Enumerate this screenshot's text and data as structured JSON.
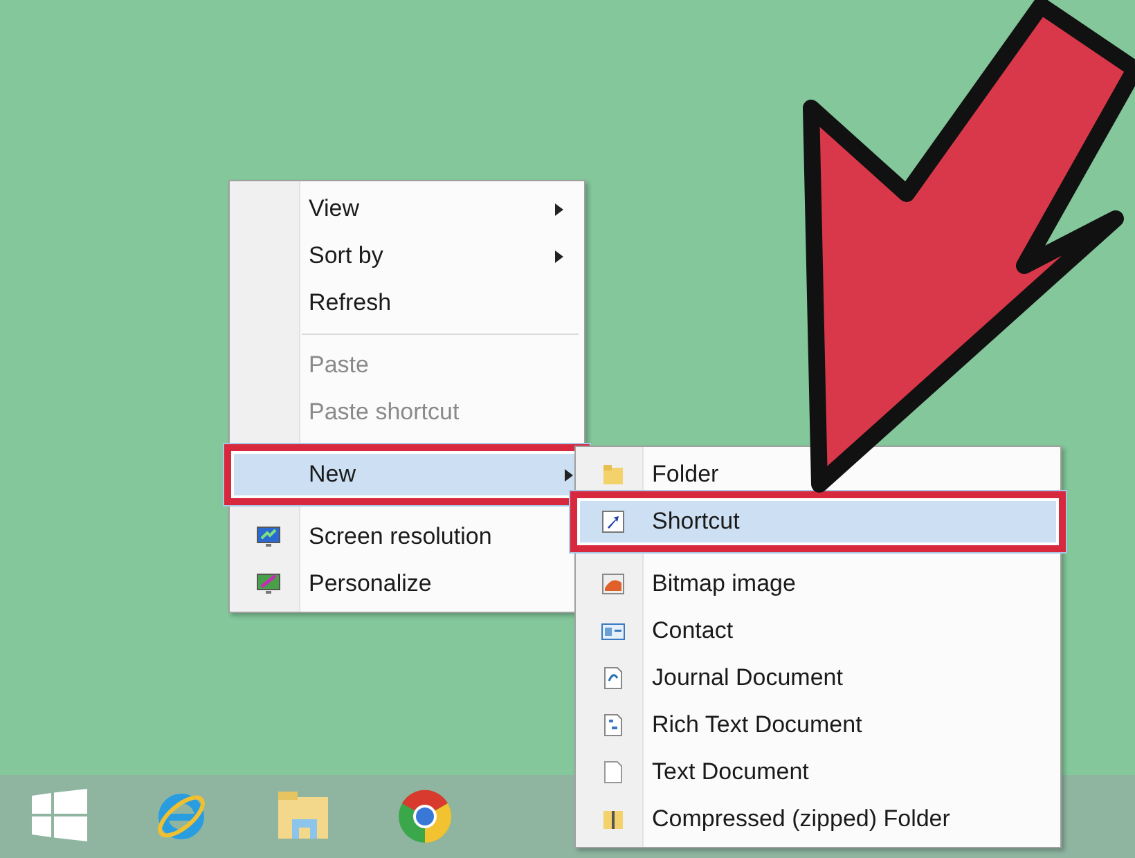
{
  "context_menu": {
    "sections": [
      {
        "items": [
          {
            "label": "View",
            "kind": "plain",
            "has_submenu": true,
            "disabled": false,
            "selected": false,
            "annotated": false
          },
          {
            "label": "Sort by",
            "kind": "plain",
            "has_submenu": true,
            "disabled": false,
            "selected": false,
            "annotated": false
          },
          {
            "label": "Refresh",
            "kind": "plain",
            "has_submenu": false,
            "disabled": false,
            "selected": false,
            "annotated": false
          }
        ]
      },
      {
        "items": [
          {
            "label": "Paste",
            "kind": "plain",
            "has_submenu": false,
            "disabled": true,
            "selected": false,
            "annotated": false
          },
          {
            "label": "Paste shortcut",
            "kind": "plain",
            "has_submenu": false,
            "disabled": true,
            "selected": false,
            "annotated": false
          }
        ]
      },
      {
        "items": [
          {
            "label": "New",
            "kind": "plain",
            "has_submenu": true,
            "disabled": false,
            "selected": true,
            "annotated": true
          }
        ]
      },
      {
        "items": [
          {
            "label": "Screen resolution",
            "kind": "display",
            "has_submenu": false,
            "disabled": false,
            "selected": false,
            "annotated": false
          },
          {
            "label": "Personalize",
            "kind": "personalize",
            "has_submenu": false,
            "disabled": false,
            "selected": false,
            "annotated": false
          }
        ]
      }
    ]
  },
  "new_submenu": {
    "sections": [
      {
        "items": [
          {
            "label": "Folder",
            "kind": "folder",
            "has_submenu": false,
            "disabled": false,
            "selected": false,
            "annotated": false
          },
          {
            "label": "Shortcut",
            "kind": "shortcut",
            "has_submenu": false,
            "disabled": false,
            "selected": true,
            "annotated": true
          }
        ]
      },
      {
        "items": [
          {
            "label": "Bitmap image",
            "kind": "bitmap",
            "has_submenu": false,
            "disabled": false,
            "selected": false,
            "annotated": false
          },
          {
            "label": "Contact",
            "kind": "contact",
            "has_submenu": false,
            "disabled": false,
            "selected": false,
            "annotated": false
          },
          {
            "label": "Journal Document",
            "kind": "journal",
            "has_submenu": false,
            "disabled": false,
            "selected": false,
            "annotated": false
          },
          {
            "label": "Rich Text Document",
            "kind": "richtext",
            "has_submenu": false,
            "disabled": false,
            "selected": false,
            "annotated": false
          },
          {
            "label": "Text Document",
            "kind": "text",
            "has_submenu": false,
            "disabled": false,
            "selected": false,
            "annotated": false
          },
          {
            "label": "Compressed (zipped) Folder",
            "kind": "zip",
            "has_submenu": false,
            "disabled": false,
            "selected": false,
            "annotated": false
          }
        ]
      }
    ]
  },
  "taskbar": {
    "apps": [
      {
        "kind": "start"
      },
      {
        "kind": "ie"
      },
      {
        "kind": "explorer"
      },
      {
        "kind": "chrome"
      }
    ]
  }
}
